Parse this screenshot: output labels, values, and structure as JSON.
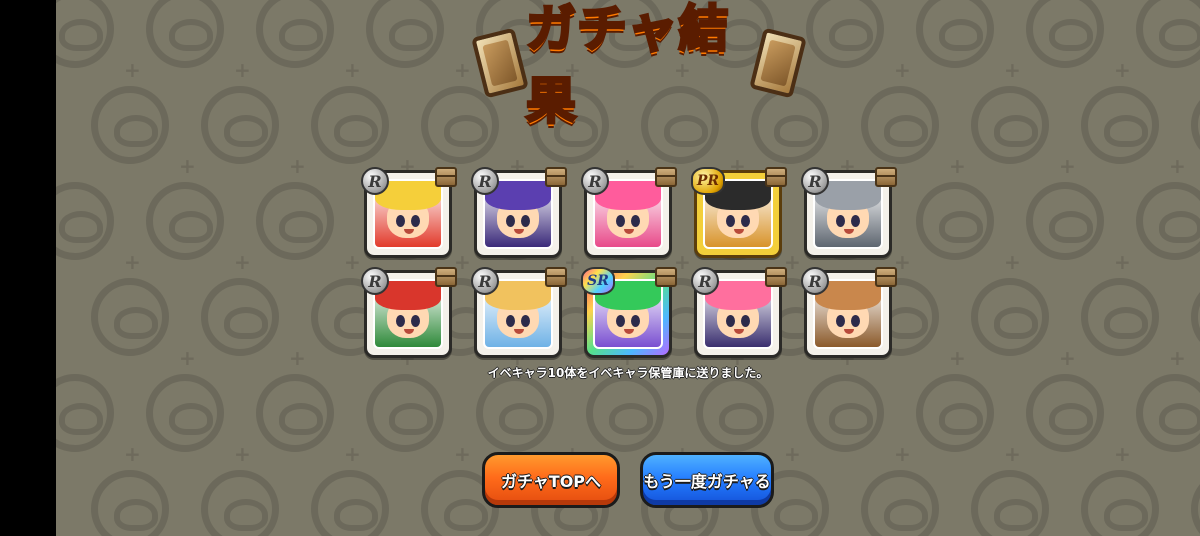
{
  "title": "ガチャ結果",
  "results": [
    {
      "rarity": "R",
      "hair": "#f5cf3a",
      "accent": "#e23b2c"
    },
    {
      "rarity": "R",
      "hair": "#5b3fb0",
      "accent": "#3b2a7a"
    },
    {
      "rarity": "R",
      "hair": "#ff5c9c",
      "accent": "#e84a8a"
    },
    {
      "rarity": "PR",
      "hair": "#2b2b2b",
      "accent": "#d8932a"
    },
    {
      "rarity": "R",
      "hair": "#9aa0a8",
      "accent": "#5e6670"
    },
    {
      "rarity": "R",
      "hair": "#d9362c",
      "accent": "#2f8a3a"
    },
    {
      "rarity": "R",
      "hair": "#f1c25e",
      "accent": "#6fb2e6"
    },
    {
      "rarity": "SR",
      "hair": "#34c95a",
      "accent": "#7a4fd1"
    },
    {
      "rarity": "R",
      "hair": "#ff6f9e",
      "accent": "#3a2f6f"
    },
    {
      "rarity": "R",
      "hair": "#c9874c",
      "accent": "#8b5a2b"
    }
  ],
  "message": "イベキャラ10体をイベキャラ保管庫に送りました。",
  "buttons": {
    "gacha_top": "ガチャTOPへ",
    "gacha_again": "もう一度ガチャる"
  },
  "colors": {
    "background": "#7c7968",
    "title_fill": "#ffd600",
    "button_orange": "#ff6b1a",
    "button_blue": "#237bff"
  }
}
